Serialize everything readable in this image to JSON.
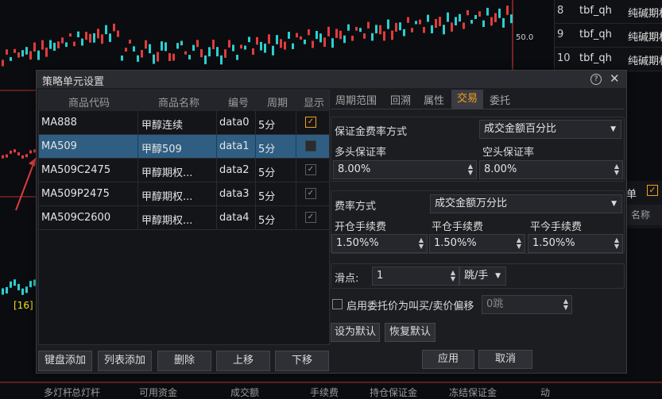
{
  "background": {
    "right_table": [
      {
        "num": "8",
        "code": "tbf_qh",
        "name": "纯碱期权"
      },
      {
        "num": "9",
        "code": "tbf_qh",
        "name": "纯碱期权"
      },
      {
        "num": "10",
        "code": "tbf_qh",
        "name": "纯碱期权"
      }
    ],
    "price_label": "50.0",
    "bubble_label": "[16]",
    "right_panel_label": "单",
    "right_panel_header": "名称",
    "bottom_tabs": [
      "多灯杆",
      "总灯杆",
      "可用资金",
      "成交额",
      "手续费",
      "持仓保证金",
      "冻结保证金",
      "动"
    ]
  },
  "dialog": {
    "title": "策略单元设置",
    "columns": [
      "商品代码",
      "商品名称",
      "编号",
      "周期",
      "显示"
    ],
    "rows": [
      {
        "code": "MA888",
        "name": "甲醇连续",
        "id": "data0",
        "period": "5分",
        "show": true
      },
      {
        "code": "MA509",
        "name": "甲醇509",
        "id": "data1",
        "period": "5分",
        "show": false
      },
      {
        "code": "MA509C2475",
        "name": "甲醇期权...",
        "id": "data2",
        "period": "5分",
        "show": true
      },
      {
        "code": "MA509P2475",
        "name": "甲醇期权...",
        "id": "data3",
        "period": "5分",
        "show": true
      },
      {
        "code": "MA509C2600",
        "name": "甲醇期权...",
        "id": "data4",
        "period": "5分",
        "show": true
      }
    ],
    "left_buttons": [
      "键盘添加",
      "列表添加",
      "删除",
      "上移",
      "下移"
    ],
    "tabs": [
      "周期范围",
      "回溯",
      "属性",
      "交易",
      "委托"
    ],
    "active_tab": "交易",
    "margin": {
      "method_label": "保证金费率方式",
      "method_value": "成交金额百分比",
      "long_label": "多头保证率",
      "long_value": "8.00%",
      "short_label": "空头保证率",
      "short_value": "8.00%"
    },
    "fee": {
      "method_label": "费率方式",
      "method_value": "成交金额万分比",
      "open_label": "开仓手续费",
      "open_value": "1.50%%",
      "close_label": "平仓手续费",
      "close_value": "1.50%%",
      "close_today_label": "平今手续费",
      "close_today_value": "1.50%%"
    },
    "slippage": {
      "label": "滑点:",
      "value": "1",
      "unit": "跳/手"
    },
    "entrust": {
      "label": "启用委托价为叫买/卖价偏移",
      "value": "0跳"
    },
    "set_default": "设为默认",
    "restore_default": "恢复默认",
    "apply": "应用",
    "cancel": "取消"
  },
  "colors": {
    "accent": "#f0a020",
    "selection": "#2f5e82",
    "candle_up": "#e03c3c",
    "candle_down": "#2ad0d0"
  }
}
